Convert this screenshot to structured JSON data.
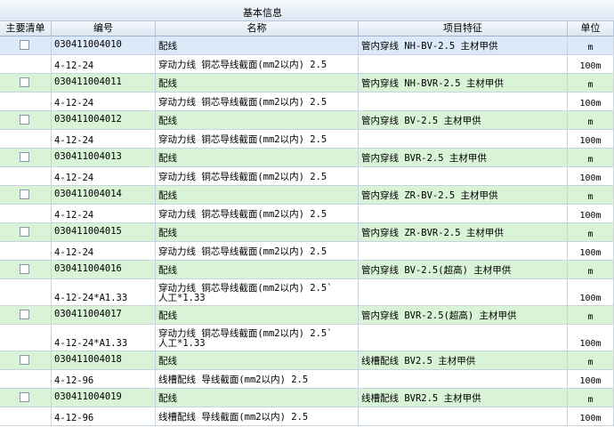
{
  "header": {
    "group_title": "基本信息",
    "columns": {
      "main_list": "主要清单",
      "code": "编号",
      "name": "名称",
      "feature": "项目特征",
      "unit": "单位"
    }
  },
  "rows": [
    {
      "kind": "list",
      "selected": true,
      "code": "030411004010",
      "name": "配线",
      "feature": "管内穿线 NH-BV-2.5  主材甲供",
      "unit": "m"
    },
    {
      "kind": "quota",
      "code": "4-12-24",
      "name": "穿动力线 铜芯导线截面(mm2以内) 2.5",
      "unit": "100m"
    },
    {
      "kind": "list",
      "code": "030411004011",
      "name": "配线",
      "feature": "管内穿线 NH-BVR-2.5  主材甲供",
      "unit": "m"
    },
    {
      "kind": "quota",
      "code": "4-12-24",
      "name": "穿动力线 铜芯导线截面(mm2以内) 2.5",
      "unit": "100m"
    },
    {
      "kind": "list",
      "code": "030411004012",
      "name": "配线",
      "feature": "管内穿线 BV-2.5  主材甲供",
      "unit": "m"
    },
    {
      "kind": "quota",
      "code": "4-12-24",
      "name": "穿动力线 铜芯导线截面(mm2以内) 2.5",
      "unit": "100m"
    },
    {
      "kind": "list",
      "code": "030411004013",
      "name": "配线",
      "feature": "管内穿线 BVR-2.5  主材甲供",
      "unit": "m"
    },
    {
      "kind": "quota",
      "code": "4-12-24",
      "name": "穿动力线 铜芯导线截面(mm2以内) 2.5",
      "unit": "100m"
    },
    {
      "kind": "list",
      "code": "030411004014",
      "name": "配线",
      "feature": "管内穿线 ZR-BV-2.5  主材甲供",
      "unit": "m"
    },
    {
      "kind": "quota",
      "code": "4-12-24",
      "name": "穿动力线 铜芯导线截面(mm2以内) 2.5",
      "unit": "100m"
    },
    {
      "kind": "list",
      "code": "030411004015",
      "name": "配线",
      "feature": "管内穿线 ZR-BVR-2.5  主材甲供",
      "unit": "m"
    },
    {
      "kind": "quota",
      "code": "4-12-24",
      "name": "穿动力线 铜芯导线截面(mm2以内) 2.5",
      "unit": "100m"
    },
    {
      "kind": "list",
      "code": "030411004016",
      "name": "配线",
      "feature": "管内穿线 BV-2.5(超高)   主材甲供",
      "unit": "m"
    },
    {
      "kind": "quota",
      "tall": true,
      "check": true,
      "code": "4-12-24*A1.33",
      "name": "穿动力线 铜芯导线截面(mm2以内) 2.5`",
      "name2": "人工*1.33",
      "unit": "100m"
    },
    {
      "kind": "list",
      "code": "030411004017",
      "name": "配线",
      "feature": "管内穿线 BVR-2.5(超高)   主材甲供",
      "unit": "m"
    },
    {
      "kind": "quota",
      "tall": true,
      "check": true,
      "code": "4-12-24*A1.33",
      "name": "穿动力线 铜芯导线截面(mm2以内) 2.5`",
      "name2": "人工*1.33",
      "unit": "100m"
    },
    {
      "kind": "list",
      "code": "030411004018",
      "name": "配线",
      "feature": "线槽配线 BV2.5  主材甲供",
      "unit": "m"
    },
    {
      "kind": "quota",
      "code": "4-12-96",
      "name": "线槽配线 导线截面(mm2以内) 2.5",
      "unit": "100m"
    },
    {
      "kind": "list",
      "code": "030411004019",
      "name": "配线",
      "feature": "线槽配线 BVR2.5  主材甲供",
      "unit": "m"
    },
    {
      "kind": "quota",
      "code": "4-12-96",
      "name": "线槽配线 导线截面(mm2以内) 2.5",
      "unit": "100m"
    }
  ],
  "icons": {
    "swap": "换",
    "check": "✓"
  }
}
